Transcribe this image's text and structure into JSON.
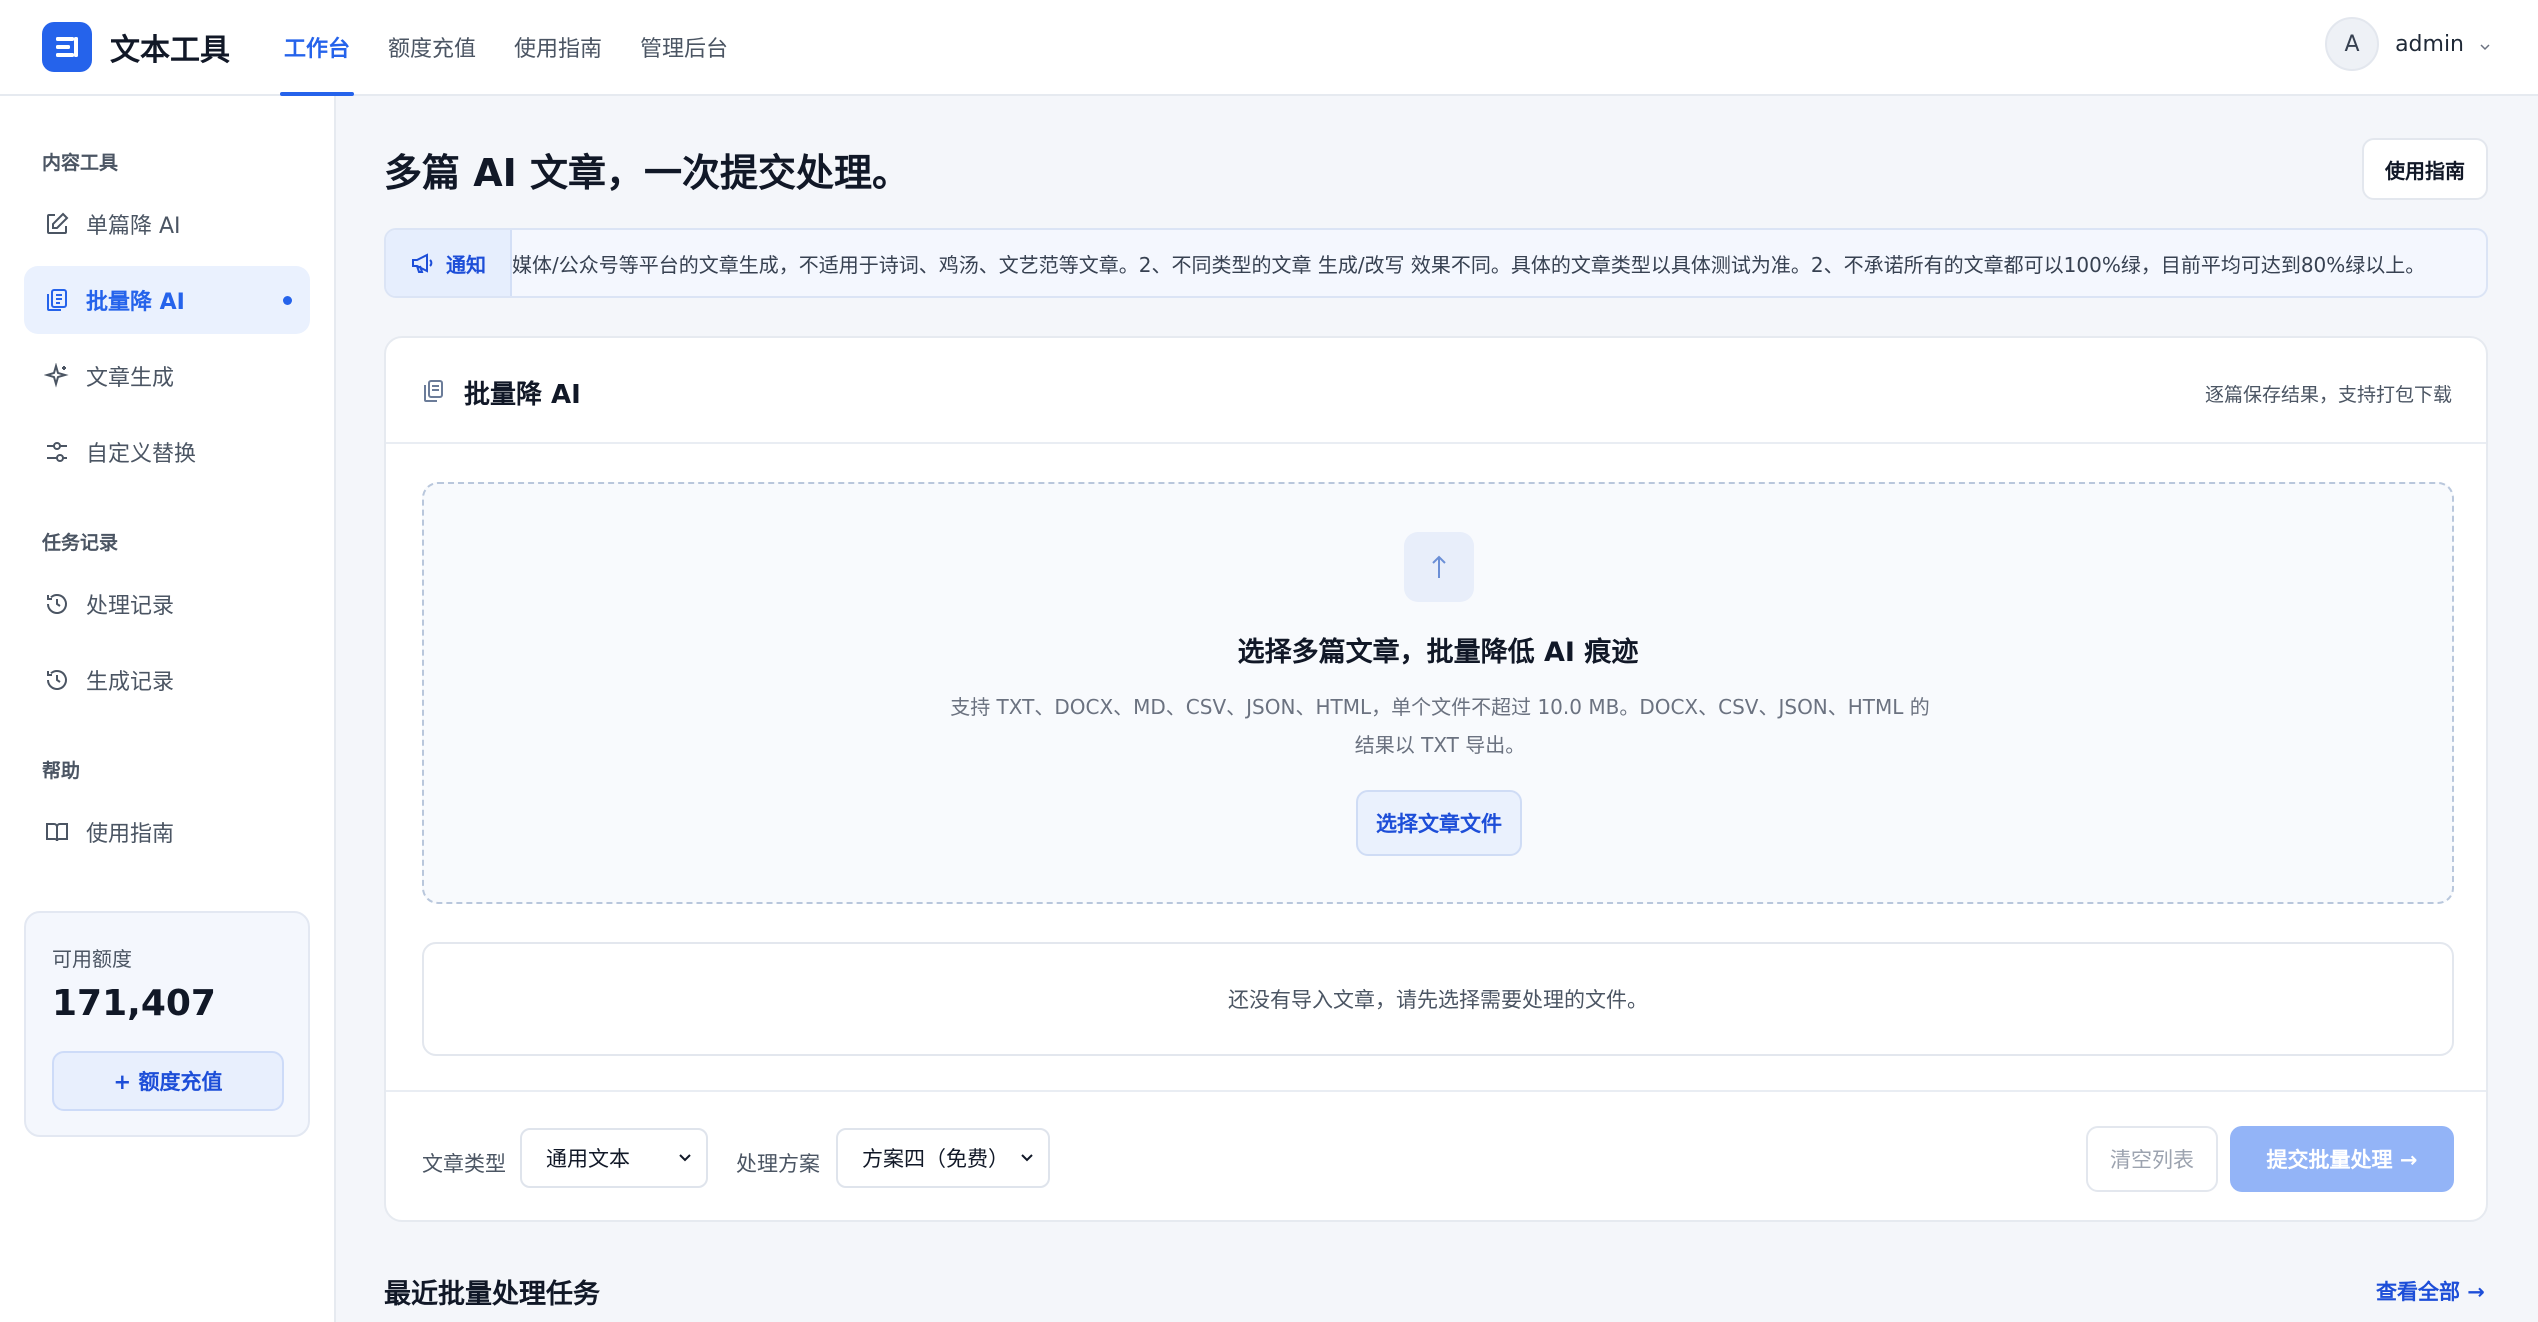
{
  "brand": {
    "name": "文本工具"
  },
  "topnav": [
    {
      "label": "工作台",
      "active": true
    },
    {
      "label": "额度充值"
    },
    {
      "label": "使用指南"
    },
    {
      "label": "管理后台"
    }
  ],
  "user": {
    "avatar_letter": "A",
    "name": "admin"
  },
  "sidebar": {
    "sections": [
      {
        "title": "内容工具"
      },
      {
        "title": "任务记录"
      },
      {
        "title": "帮助"
      }
    ],
    "items": [
      {
        "label": "单篇降 AI",
        "icon": "edit-icon"
      },
      {
        "label": "批量降 AI",
        "icon": "files-icon",
        "active": true
      },
      {
        "label": "文章生成",
        "icon": "sparkle-icon"
      },
      {
        "label": "自定义替换",
        "icon": "sliders-icon"
      },
      {
        "label": "处理记录",
        "icon": "history-icon"
      },
      {
        "label": "生成记录",
        "icon": "history-icon"
      },
      {
        "label": "使用指南",
        "icon": "book-icon"
      }
    ],
    "quota": {
      "label": "可用额度",
      "value": "171,407",
      "button": "+ 额度充值"
    }
  },
  "main": {
    "title": "多篇 AI 文章，一次提交处理。",
    "guide_button": "使用指南",
    "notice": {
      "tag": "通知",
      "text": "媒体/公众号等平台的文章生成，不适用于诗词、鸡汤、文艺范等文章。2、不同类型的文章 生成/改写 效果不同。具体的文章类型以具体测试为准。2、不承诺所有的文章都可以100%绿，目前平均可达到80%绿以上。"
    },
    "card": {
      "title": "批量降 AI",
      "subtitle": "逐篇保存结果，支持打包下载",
      "dropzone": {
        "title": "选择多篇文章，批量降低 AI 痕迹",
        "desc_line1": "支持 TXT、DOCX、MD、CSV、JSON、HTML，单个文件不超过 10.0 MB。DOCX、CSV、JSON、HTML 的",
        "desc_line2": "结果以 TXT 导出。",
        "button": "选择文章文件"
      },
      "empty": "还没有导入文章，请先选择需要处理的文件。",
      "footer": {
        "type_label": "文章类型",
        "type_value": "通用文本",
        "plan_label": "处理方案",
        "plan_value": "方案四（免费）",
        "clear": "清空列表",
        "submit": "提交批量处理 →"
      }
    },
    "recent": {
      "title": "最近批量处理任务",
      "link": "查看全部 →"
    }
  },
  "colors": {
    "accent": "#2563eb",
    "submit_disabled": "#93b4f7",
    "background": "#f4f6fa"
  }
}
